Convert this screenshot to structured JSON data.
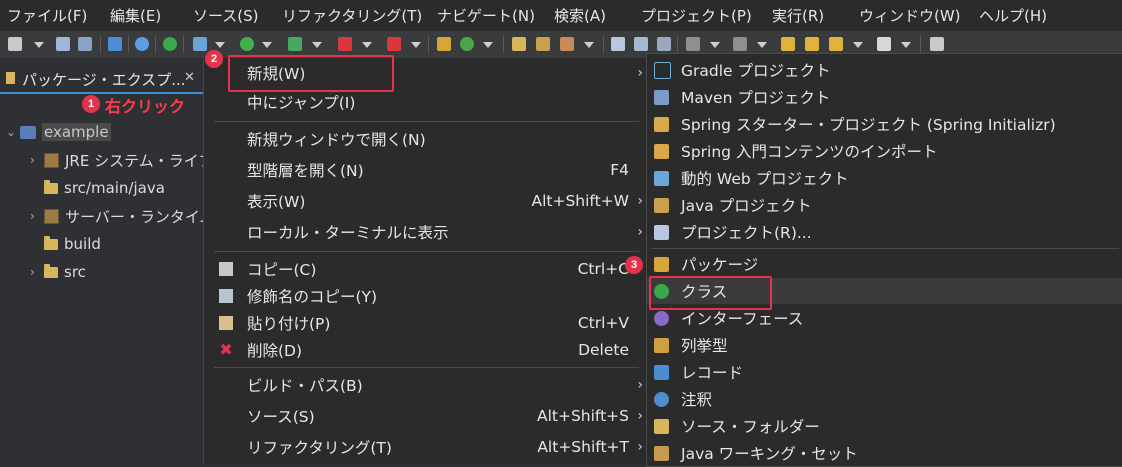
{
  "menubar": {
    "items": [
      "ファイル(F)",
      "編集(E)",
      "ソース(S)",
      "リファクタリング(T)",
      "ナビゲート(N)",
      "検索(A)",
      "プロジェクト(P)",
      "実行(R)",
      "ウィンドウ(W)",
      "ヘルプ(H)"
    ]
  },
  "explorer": {
    "tab_title": "パッケージ・エクスプ...",
    "close_glyph": "✕",
    "tree": [
      {
        "label": "example",
        "icon": "project-icon"
      },
      {
        "label": "JRE システム・ライブ",
        "icon": "library-icon"
      },
      {
        "label": "src/main/java",
        "icon": "source-folder-icon"
      },
      {
        "label": "サーバー・ランタイム",
        "icon": "library-icon"
      },
      {
        "label": "build",
        "icon": "folder-icon"
      },
      {
        "label": "src",
        "icon": "folder-icon"
      }
    ]
  },
  "annotations": {
    "step1_number": "1",
    "step1_text": "右クリック",
    "step2_number": "2",
    "step3_number": "3"
  },
  "context_menu": {
    "items": [
      {
        "label": "新規(W)",
        "accel": "",
        "submenu": true
      },
      {
        "label": "中にジャンプ(I)",
        "accel": "",
        "submenu": false
      },
      {
        "label": "新規ウィンドウで開く(N)",
        "accel": "",
        "submenu": false
      },
      {
        "label": "型階層を開く(N)",
        "accel": "F4",
        "submenu": false
      },
      {
        "label": "表示(W)",
        "accel": "Alt+Shift+W",
        "submenu": true
      },
      {
        "label": "ローカル・ターミナルに表示",
        "accel": "",
        "submenu": true
      },
      {
        "label": "コピー(C)",
        "accel": "Ctrl+C",
        "submenu": false,
        "icon": "copy-icon"
      },
      {
        "label": "修飾名のコピー(Y)",
        "accel": "",
        "submenu": false,
        "icon": "copy-qualified-icon"
      },
      {
        "label": "貼り付け(P)",
        "accel": "Ctrl+V",
        "submenu": false,
        "icon": "paste-icon"
      },
      {
        "label": "削除(D)",
        "accel": "Delete",
        "submenu": false,
        "icon": "delete-icon"
      },
      {
        "label": "ビルド・パス(B)",
        "accel": "",
        "submenu": true
      },
      {
        "label": "ソース(S)",
        "accel": "Alt+Shift+S",
        "submenu": true
      },
      {
        "label": "リファクタリング(T)",
        "accel": "Alt+Shift+T",
        "submenu": true
      }
    ],
    "submenu_glyph": "›"
  },
  "new_submenu": {
    "items": [
      {
        "label": "Gradle プロジェクト",
        "icon": "gradle-icon"
      },
      {
        "label": "Maven プロジェクト",
        "icon": "maven-icon"
      },
      {
        "label": "Spring スターター・プロジェクト (Spring Initializr)",
        "icon": "spring-icon"
      },
      {
        "label": "Spring 入門コンテンツのインポート",
        "icon": "spring-import-icon"
      },
      {
        "label": "動的 Web プロジェクト",
        "icon": "web-project-icon"
      },
      {
        "label": "Java プロジェクト",
        "icon": "java-project-icon"
      },
      {
        "label": "プロジェクト(R)...",
        "icon": "project-icon"
      },
      {
        "label": "パッケージ",
        "icon": "package-icon"
      },
      {
        "label": "クラス",
        "icon": "class-icon"
      },
      {
        "label": "インターフェース",
        "icon": "interface-icon"
      },
      {
        "label": "列挙型",
        "icon": "enum-icon"
      },
      {
        "label": "レコード",
        "icon": "record-icon"
      },
      {
        "label": "注釈",
        "icon": "annotation-icon"
      },
      {
        "label": "ソース・フォルダー",
        "icon": "source-folder-icon"
      },
      {
        "label": "Java ワーキング・セット",
        "icon": "working-set-icon"
      }
    ]
  },
  "colors": {
    "accent_red": "#e4334a",
    "selection_blue": "#3d8fd8"
  }
}
